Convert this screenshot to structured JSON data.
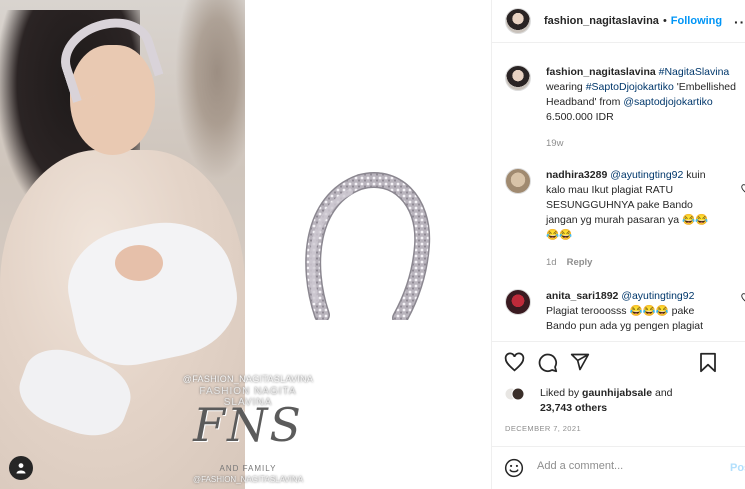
{
  "media": {
    "watermark": {
      "handle_top": "@FASHION_NAGITASLAVINA",
      "name_line": "FASHION NAGITA SLAVINA",
      "logo": "FNS",
      "tagline": "AND FAMILY",
      "handle_bottom": "@FASHION_NAGITASLAVINA"
    },
    "user_tag_icon": "person-icon"
  },
  "header": {
    "username": "fashion_nagitaslavina",
    "separator": "•",
    "follow_status": "Following",
    "more_icon": "···"
  },
  "caption": {
    "username": "fashion_nagitaslavina",
    "line1": "#NagitaSlavina",
    "line2_prefix": "wearing ",
    "line2_tag": "#SaptoDjojokartiko",
    "line2_rest": " 'Embellished",
    "line3_prefix": "Headband' from ",
    "line3_mention": "@saptodjojokartiko",
    "line4": "6.500.000 IDR",
    "age": "19w"
  },
  "comments": [
    {
      "username": "nadhira3289",
      "mention": "@ayutingting92",
      "lines": [
        "kuin",
        "kalo mau Ikut plagiat RATU",
        "SESUNGGUHNYA pake Bando",
        "jangan yg murah pasaran ya 😂😂",
        "😂😂"
      ],
      "age": "1d",
      "reply_label": "Reply"
    },
    {
      "username": "anita_sari1892",
      "mention": "@ayutingting92",
      "lines": [
        "Plagiat terooosss 😂😂😂 pake",
        "Bando pun ada yg pengen plagiat"
      ],
      "age": "",
      "reply_label": ""
    }
  ],
  "actions": {
    "icons": [
      "heart-icon",
      "comment-icon",
      "share-icon",
      "bookmark-icon"
    ],
    "liked_by_prefix": "Liked by ",
    "liked_by_user": "gaunhijabsale",
    "liked_by_and": " and",
    "likes_count": "23,743 others",
    "date": "DECEMBER 7, 2021"
  },
  "add_comment": {
    "emoji_icon": "smiley-icon",
    "placeholder": "Add a comment...",
    "post_label": "Post"
  },
  "colors": {
    "accent": "#0095f6",
    "link": "#00376b",
    "muted": "#8e8e8e"
  }
}
